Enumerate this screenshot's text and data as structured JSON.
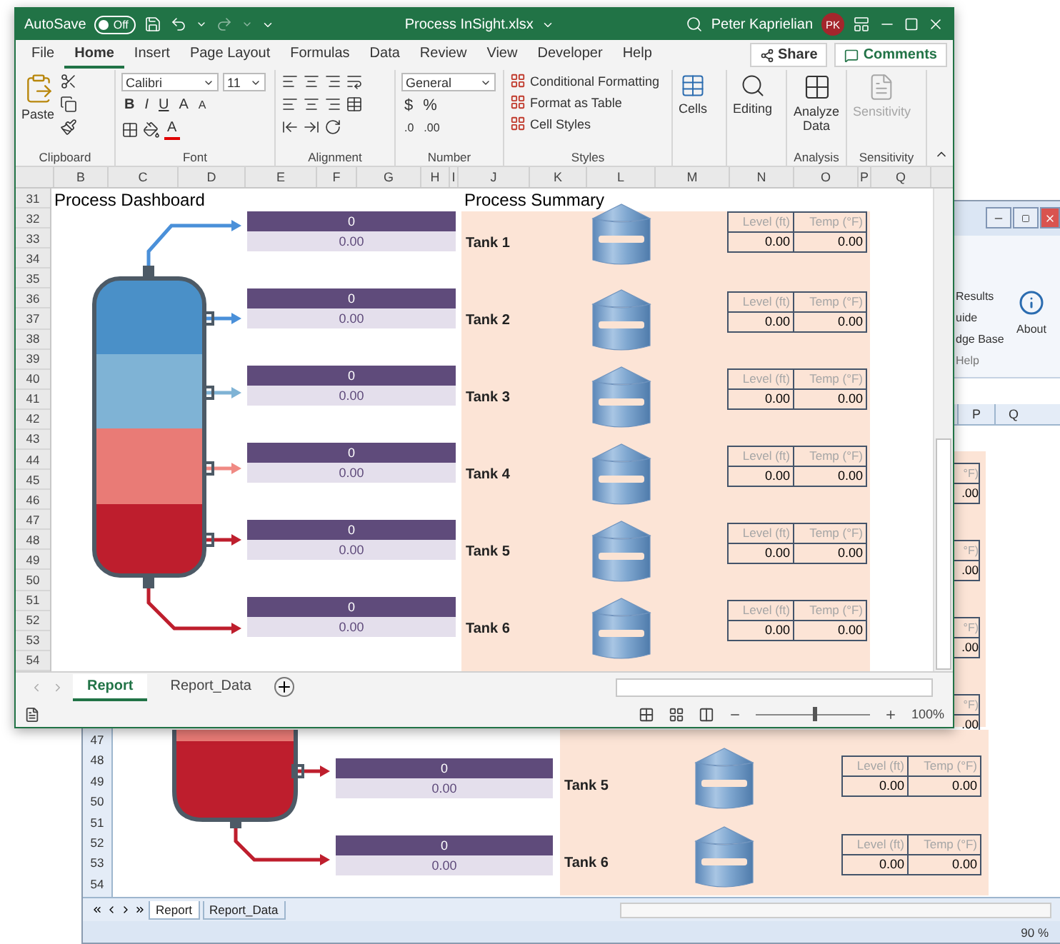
{
  "front_window": {
    "titlebar": {
      "autosave_label": "AutoSave",
      "autosave_on": false,
      "autosave_state": "Off",
      "title": "Process InSight.xlsx",
      "user": "Peter Kaprielian",
      "initials": "PK"
    },
    "tabs": [
      {
        "label": "File",
        "selected": false
      },
      {
        "label": "Home",
        "selected": true
      },
      {
        "label": "Insert",
        "selected": false
      },
      {
        "label": "Page Layout",
        "selected": false
      },
      {
        "label": "Formulas",
        "selected": false
      },
      {
        "label": "Data",
        "selected": false
      },
      {
        "label": "Review",
        "selected": false
      },
      {
        "label": "View",
        "selected": false
      },
      {
        "label": "Developer",
        "selected": false
      },
      {
        "label": "Help",
        "selected": false
      }
    ],
    "share": "Share",
    "comments": "Comments",
    "ribbon": {
      "clipboard": {
        "paste": "Paste",
        "label": "Clipboard"
      },
      "font": {
        "name": "Calibri",
        "size": "11",
        "styles": [
          "B",
          "I",
          "U"
        ],
        "grow": "A",
        "shrink": "A",
        "color_glyph": "A",
        "label": "Font"
      },
      "alignment": {
        "label": "Alignment"
      },
      "number": {
        "format": "General",
        "symbols": [
          "$",
          "%"
        ],
        "decimals": [
          ".0",
          ".00"
        ],
        "label": "Number"
      },
      "styles": {
        "items": [
          "Conditional Formatting",
          "Format as Table",
          "Cell Styles"
        ],
        "label": "Styles"
      },
      "cells": {
        "button": "Cells"
      },
      "editing": {
        "button": "Editing"
      },
      "analysis": {
        "button": "Analyze Data",
        "label": "Analysis"
      },
      "sensitivity": {
        "button": "Sensitivity",
        "label": "Sensitivity",
        "disabled": true
      }
    },
    "columns": [
      "B",
      "C",
      "D",
      "E",
      "F",
      "G",
      "H",
      "I",
      "J",
      "K",
      "L",
      "M",
      "N",
      "O",
      "P",
      "Q"
    ],
    "row_numbers": [
      "31",
      "32",
      "33",
      "34",
      "35",
      "36",
      "37",
      "38",
      "39",
      "40",
      "41",
      "42",
      "43",
      "44",
      "45",
      "46",
      "47",
      "48",
      "49",
      "50",
      "51",
      "52",
      "53",
      "54"
    ],
    "dashboard_title": "Process Dashboard",
    "summary_title": "Process Summary",
    "streams": [
      {
        "value": "0",
        "reading": "0.00"
      },
      {
        "value": "0",
        "reading": "0.00"
      },
      {
        "value": "0",
        "reading": "0.00"
      },
      {
        "value": "0",
        "reading": "0.00"
      },
      {
        "value": "0",
        "reading": "0.00"
      },
      {
        "value": "0",
        "reading": "0.00"
      }
    ],
    "tanks": [
      {
        "name": "Tank 1",
        "headers": [
          "Level (ft)",
          "Temp (°F)"
        ],
        "values": [
          "0.00",
          "0.00"
        ]
      },
      {
        "name": "Tank 2",
        "headers": [
          "Level (ft)",
          "Temp (°F)"
        ],
        "values": [
          "0.00",
          "0.00"
        ]
      },
      {
        "name": "Tank 3",
        "headers": [
          "Level (ft)",
          "Temp (°F)"
        ],
        "values": [
          "0.00",
          "0.00"
        ]
      },
      {
        "name": "Tank 4",
        "headers": [
          "Level (ft)",
          "Temp (°F)"
        ],
        "values": [
          "0.00",
          "0.00"
        ]
      },
      {
        "name": "Tank 5",
        "headers": [
          "Level (ft)",
          "Temp (°F)"
        ],
        "values": [
          "0.00",
          "0.00"
        ]
      },
      {
        "name": "Tank 6",
        "headers": [
          "Level (ft)",
          "Temp (°F)"
        ],
        "values": [
          "0.00",
          "0.00"
        ]
      }
    ],
    "sheet_tabs": [
      {
        "label": "Report",
        "selected": true
      },
      {
        "label": "Report_Data",
        "selected": false
      }
    ],
    "status_bar": {
      "zoom": "100%",
      "zoom_slider": {
        "level": 0.5
      }
    }
  },
  "back_window": {
    "ribbon": {
      "items": [
        "Results",
        "uide",
        "dge Base"
      ],
      "group": "Help",
      "about": "About"
    },
    "columns": [
      "P",
      "Q"
    ],
    "cut_tables": [
      {
        "header": "°F)",
        "value": ".00"
      },
      {
        "header": "°F)",
        "value": ".00"
      },
      {
        "header": "°F)",
        "value": ".00"
      },
      {
        "header": "°F)",
        "value": ".00"
      }
    ],
    "row_numbers": [
      "47",
      "48",
      "49",
      "50",
      "51",
      "52",
      "53",
      "54"
    ],
    "streams": [
      {
        "value": "0",
        "reading": "0.00"
      },
      {
        "value": "0",
        "reading": "0.00"
      }
    ],
    "tanks": [
      {
        "name": "Tank 5",
        "headers": [
          "Level (ft)",
          "Temp (°F)"
        ],
        "values": [
          "0.00",
          "0.00"
        ]
      },
      {
        "name": "Tank 6",
        "headers": [
          "Level (ft)",
          "Temp (°F)"
        ],
        "values": [
          "0.00",
          "0.00"
        ]
      }
    ],
    "sheet_tabs": [
      {
        "label": "Report",
        "selected": true
      },
      {
        "label": "Report_Data",
        "selected": false
      }
    ],
    "status_bar": {
      "zoom": "90 %"
    }
  }
}
